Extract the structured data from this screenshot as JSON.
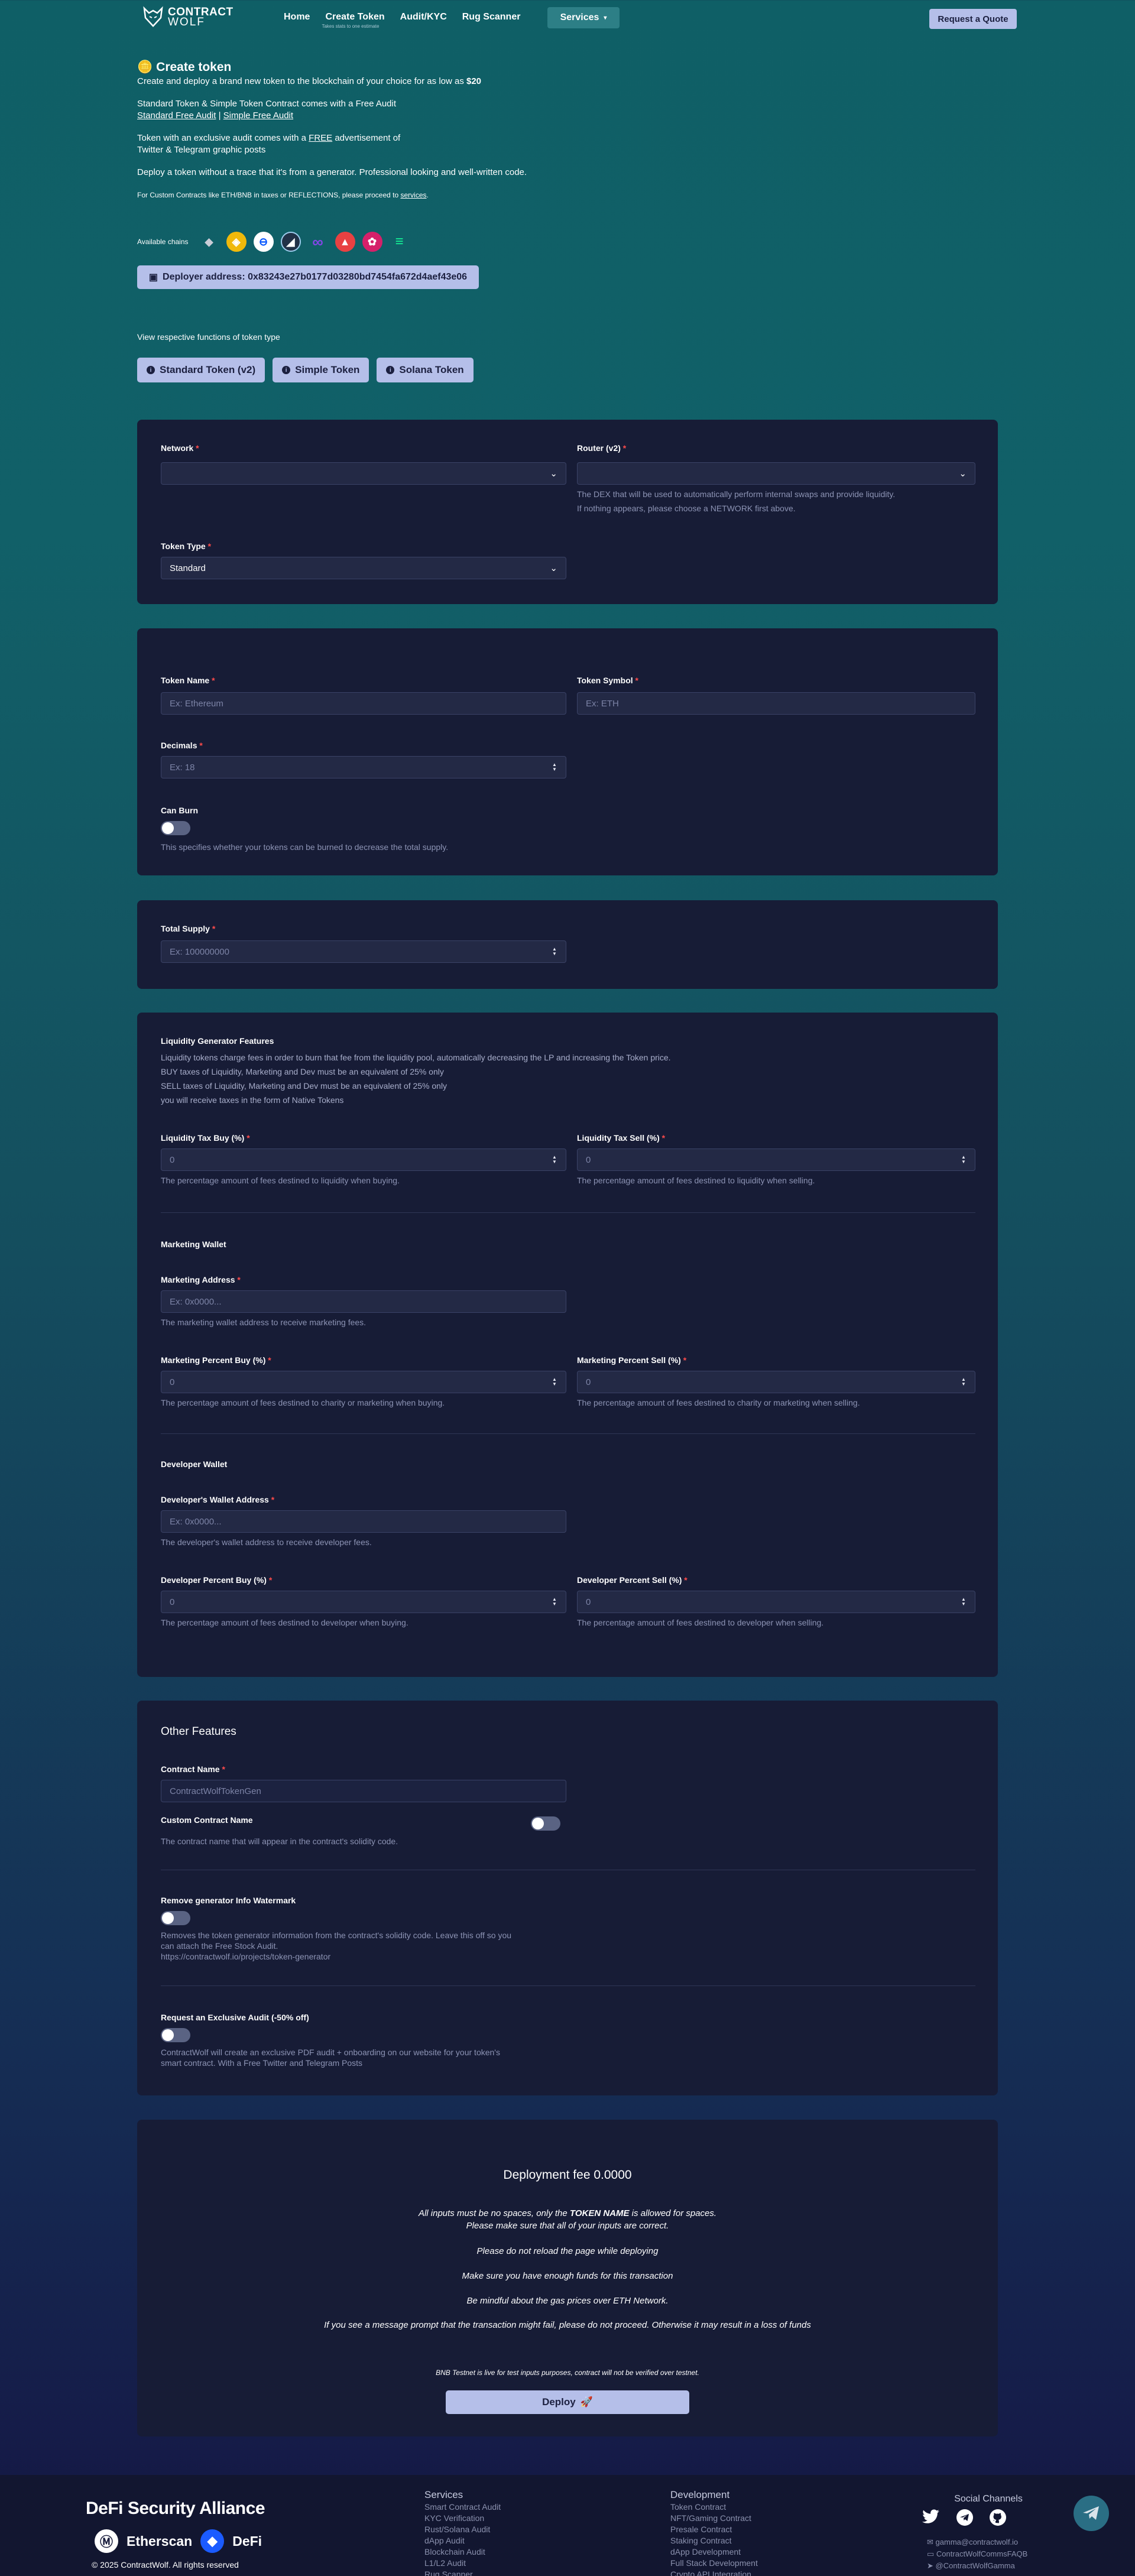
{
  "nav": {
    "brand_line1": "CONTRACT",
    "brand_line2": "WOLF",
    "links": [
      "Home",
      "Create Token",
      "Audit/KYC",
      "Rug Scanner"
    ],
    "create_sub": "Takes stats to one estimate",
    "services": "Services",
    "quote": "Request a Quote"
  },
  "intro": {
    "title": "Create token",
    "line1_pre": "Create and deploy a brand new token to the blockchain of your choice for as low as ",
    "price": "$20",
    "line2": "Standard Token & Simple Token Contract comes with a Free Audit",
    "std_audit_link": "Standard Free Audit",
    "sep": " | ",
    "simple_audit_link": "Simple Free Audit",
    "line3_pre": "Token with an exclusive audit comes with a ",
    "free": "FREE",
    "line3_post": " advertisement of",
    "line3b": "Twitter & Telegram graphic posts",
    "line4": "Deploy a token without a trace that it's from a generator. Professional looking and well-written code.",
    "line5_pre": "For Custom Contracts like ETH/BNB in taxes or REFLECTIONS, please proceed to ",
    "services_link": "services",
    "line5_post": "."
  },
  "chains_label": "Available chains",
  "chains": [
    {
      "name": "ethereum",
      "color": "#2b3240",
      "glyph": "◆"
    },
    {
      "name": "bnb",
      "color": "#f0b90b",
      "glyph": "◈"
    },
    {
      "name": "base",
      "color": "#0052ff",
      "glyph": "●"
    },
    {
      "name": "arbitrum",
      "color": "#213147",
      "glyph": "◢"
    },
    {
      "name": "polygon",
      "color": "#8247e5",
      "glyph": "∞"
    },
    {
      "name": "avalanche",
      "color": "#e84142",
      "glyph": "▲"
    },
    {
      "name": "pulsechain",
      "color": "#d5206a",
      "glyph": "✿"
    },
    {
      "name": "solana",
      "color": "#1b2140",
      "glyph": "≡"
    }
  ],
  "deployer": "Deployer address: 0x83243e27b0177d03280bd7454fa672d4aef43e06",
  "view_text": "View respective functions of token type",
  "token_types": [
    "Standard Token (v2)",
    "Simple Token",
    "Solana Token"
  ],
  "network_panel": {
    "network_label": "Network",
    "router_label": "Router (v2)",
    "router_help1": "The DEX that will be used to automatically perform internal swaps and provide liquidity.",
    "router_help2": "If nothing appears, please choose a NETWORK first above.",
    "type_label": "Token Type",
    "type_value": "Standard"
  },
  "token_panel": {
    "name_label": "Token Name",
    "name_placeholder": "Ex: Ethereum",
    "symbol_label": "Token Symbol",
    "symbol_placeholder": "Ex: ETH",
    "decimals_label": "Decimals",
    "decimals_placeholder": "Ex: 18",
    "burn_label": "Can Burn",
    "burn_help": "This specifies whether your tokens can be burned to decrease the total supply."
  },
  "supply_panel": {
    "label": "Total Supply",
    "placeholder": "Ex: 100000000"
  },
  "tax_panel": {
    "lg_title": "Liquidity Generator Features",
    "lg_desc1": "Liquidity tokens charge fees in order to burn that fee from the liquidity pool, automatically decreasing the LP and increasing the Token price.",
    "lg_desc2": "BUY taxes of Liquidity, Marketing and Dev must be an equivalent of 25% only",
    "lg_desc3": "SELL taxes of Liquidity, Marketing and Dev must be an equivalent of 25% only",
    "lg_desc4": "you will receive taxes in the form of Native Tokens",
    "liq_buy_label": "Liquidity Tax Buy (%)",
    "liq_sell_label": "Liquidity Tax Sell (%)",
    "liq_buy_help": "The percentage amount of fees destined to liquidity when buying.",
    "liq_sell_help": "The percentage amount of fees destined to liquidity when selling.",
    "zero": "0",
    "mw_title": "Marketing Wallet",
    "mw_addr_label": "Marketing Address",
    "mw_addr_placeholder": "Ex: 0x0000...",
    "mw_addr_help": "The marketing wallet address to receive marketing fees.",
    "mw_buy_label": "Marketing Percent Buy (%)",
    "mw_sell_label": "Marketing Percent Sell (%)",
    "mw_buy_help": "The percentage amount of fees destined to charity or marketing when buying.",
    "mw_sell_help": "The percentage amount of fees destined to charity or marketing when selling.",
    "dw_title": "Developer Wallet",
    "dw_addr_label": "Developer's Wallet Address",
    "dw_addr_placeholder": "Ex: 0x0000...",
    "dw_addr_help": "The developer's wallet address to receive developer fees.",
    "dw_buy_label": "Developer Percent Buy (%)",
    "dw_sell_label": "Developer Percent Sell (%)",
    "dw_buy_help": "The percentage amount of fees destined to developer when buying.",
    "dw_sell_help": "The percentage amount of fees destined to developer when selling."
  },
  "other_panel": {
    "title": "Other Features",
    "contract_name_label": "Contract Name",
    "contract_name_placeholder": "ContractWolfTokenGen",
    "custom_label": "Custom Contract Name",
    "custom_help": "The contract name that will appear in the contract's solidity code.",
    "watermark_label": "Remove generator Info Watermark",
    "watermark_help1": "Removes the token generator information from the contract's solidity code. Leave this off so you",
    "watermark_help2": "can attach the Free Stock Audit.",
    "watermark_help3": "https://contractwolf.io/projects/token-generator",
    "audit_label": "Request an Exclusive Audit (-50% off)",
    "audit_help1": "ContractWolf will create an exclusive PDF audit + onboarding on our website for your token's",
    "audit_help2": "smart contract. With a Free Twitter and Telegram Posts"
  },
  "deploy_panel": {
    "fee": "Deployment fee 0.0000",
    "n1_pre": "All inputs must be no spaces, only the ",
    "n1_bold": "TOKEN NAME",
    "n1_post": " is allowed for spaces.",
    "n2": "Please make sure that all of your inputs are correct.",
    "n3": "Please do not reload the page while deploying",
    "n4": "Make sure you have enough funds for this transaction",
    "n5": "Be mindful about the gas prices over ETH Network.",
    "n6": "If you see a message prompt that the transaction might fail, please do not proceed. Otherwise it may result in a loss of funds",
    "n7": "BNB Testnet is live for test inputs purposes, contract will not be verified over testnet.",
    "button": "Deploy"
  },
  "footer": {
    "alliance": "DeFi Security Alliance",
    "etherscan": "Etherscan",
    "defi": "DeFi",
    "copyright": "© 2025 ContractWolf. All rights reserved",
    "services_title": "Services",
    "services": [
      "Smart Contract Audit",
      "KYC Verification",
      "Rust/Solana Audit",
      "dApp Audit",
      "Blockchain Audit",
      "L1/L2 Audit",
      "Rug Scanner"
    ],
    "dev_title": "Development",
    "dev": [
      "Token Contract",
      "NFT/Gaming Contract",
      "Presale Contract",
      "Staking Contract",
      "dApp Development",
      "Full Stack Development",
      "Crypto API Integration"
    ],
    "social_title": "Social Channels",
    "email": "gamma@contractwolf.io",
    "handle1": "ContractWolfCommsFAQB",
    "handle2": "@ContractWolfGamma"
  }
}
